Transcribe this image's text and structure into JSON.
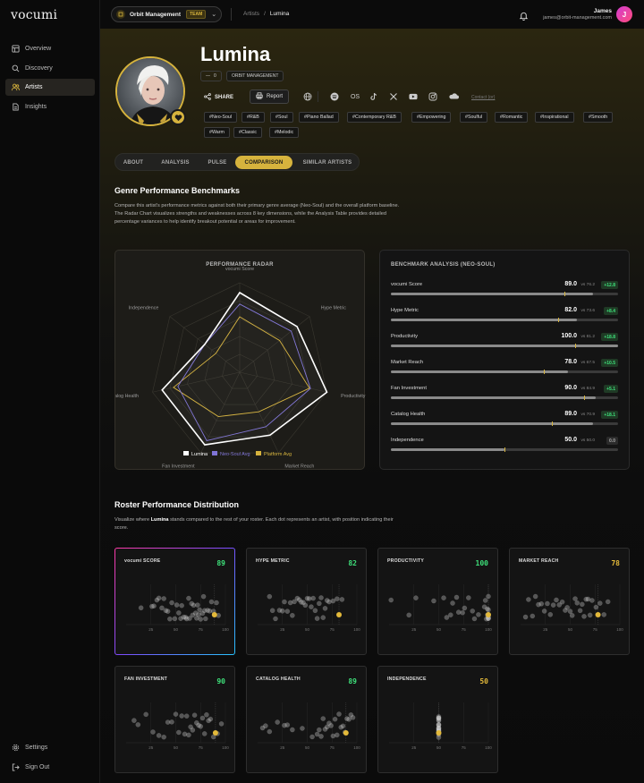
{
  "sidebar": {
    "logo": "vocumi",
    "nav": [
      {
        "label": "Overview",
        "icon": "grid-icon"
      },
      {
        "label": "Discovery",
        "icon": "search-icon"
      },
      {
        "label": "Artists",
        "icon": "users-icon",
        "active": true
      },
      {
        "label": "Insights",
        "icon": "document-icon"
      }
    ],
    "bottom": [
      {
        "label": "Settings",
        "icon": "gear-icon"
      },
      {
        "label": "Sign Out",
        "icon": "sign-out-icon"
      }
    ]
  },
  "topbar": {
    "org": "Orbit Management",
    "org_badge": "TEAM",
    "breadcrumb": [
      "Artists",
      "/",
      "Lumina"
    ],
    "user_name": "James",
    "user_email": "james@orbit-management.com",
    "avatar_letter": "J"
  },
  "artist": {
    "name": "Lumina",
    "followers": "0",
    "org_label": "ORBIT MANAGEMENT",
    "share_label": "SHARE",
    "report_label": "Report",
    "contact_label": "Contact (or)",
    "social_icons": [
      "globe-icon",
      "spotify-icon",
      "os-icon",
      "tiktok-icon",
      "x-icon",
      "youtube-icon",
      "instagram-icon",
      "soundcloud-icon"
    ],
    "os_text": "OS",
    "tags": [
      "#Neo-Soul",
      "#R&B",
      "#Soul",
      "#Piano Ballad",
      "#Contemporary R&B",
      "#Empowering",
      "#Soulful",
      "#Romantic",
      "#Inspirational",
      "#Smooth",
      "#Warm",
      "#Classic",
      "#Melodic"
    ]
  },
  "tabs": [
    "ABOUT",
    "ANALYSIS",
    "PULSE",
    "COMPARISON",
    "SIMILAR ARTISTS"
  ],
  "active_tab": "COMPARISON",
  "genre_section": {
    "title": "Genre Performance Benchmarks",
    "description_1": "Compare this artist's performance metrics against both their primary genre average (Neo-Soul) and the overall platform baseline.",
    "description_2": "The Radar Chart visualizes strengths and weaknesses across 8 key dimensions, while the Analysis Table provides detailed",
    "description_3": "percentage variances to help identify breakout potential or areas for improvement."
  },
  "radar": {
    "title": "PERFORMANCE RADAR",
    "legend": [
      "Lumina",
      "Neo-Soul Avg",
      "Platform Avg"
    ]
  },
  "chart_data": [
    {
      "type": "radar",
      "title": "PERFORMANCE RADAR",
      "axes": [
        "vocumi Score",
        "Hype Metric",
        "Productivity",
        "Market Reach",
        "Fan Investment",
        "Catalog Health",
        "Independence"
      ],
      "rmax": 100,
      "grid": true,
      "legend_position": "bottom",
      "series": [
        {
          "name": "Lumina",
          "color": "#ffffff",
          "values": [
            89,
            82,
            100,
            78,
            90,
            89,
            50
          ]
        },
        {
          "name": "Neo-Soul Avg",
          "color": "#7f74d6",
          "values": [
            76.2,
            73.6,
            81.2,
            67.5,
            84.9,
            70.9,
            50
          ]
        },
        {
          "name": "Platform Avg",
          "color": "#d6b33d",
          "values": [
            62,
            57,
            80,
            49,
            55,
            76,
            34
          ]
        }
      ]
    },
    {
      "type": "scatter",
      "title": "vocumi SCORE",
      "score": 89,
      "score_color": "#3ee07a",
      "xticks": [
        "25",
        "50",
        "75",
        "100"
      ],
      "xlim": [
        0,
        100
      ],
      "highlight_x": 89,
      "points": [
        15,
        26,
        28,
        31,
        33,
        36,
        38,
        40,
        42,
        44,
        46,
        49,
        51,
        53,
        55,
        56,
        58,
        60,
        61,
        63,
        64,
        66,
        67,
        68,
        70,
        71,
        72,
        73,
        74,
        75,
        77,
        78,
        79,
        80,
        82,
        84,
        86,
        88,
        91,
        93
      ]
    },
    {
      "type": "scatter",
      "title": "HYPE METRIC",
      "score": 82,
      "score_color": "#3ee07a",
      "xticks": [
        "25",
        "50",
        "75",
        "100"
      ],
      "xlim": [
        0,
        100
      ],
      "highlight_x": 82,
      "points": [
        12,
        15,
        18,
        22,
        25,
        27,
        30,
        33,
        35,
        37,
        40,
        42,
        44,
        46,
        48,
        50,
        52,
        54,
        56,
        58,
        60,
        62,
        64,
        66,
        68,
        70,
        72,
        76,
        80,
        85
      ]
    },
    {
      "type": "scatter",
      "title": "PRODUCTIVITY",
      "score": 100,
      "score_color": "#3ee07a",
      "xticks": [
        "25",
        "50",
        "75",
        "100"
      ],
      "xlim": [
        0,
        100
      ],
      "highlight_x": 100,
      "points": [
        2,
        20,
        27,
        45,
        55,
        58,
        62,
        64,
        68,
        70,
        74,
        76,
        80,
        84,
        86,
        90,
        96,
        97,
        98,
        99,
        99,
        100,
        100,
        100,
        100,
        100,
        100,
        100
      ]
    },
    {
      "type": "scatter",
      "title": "MARKET REACH",
      "score": 78,
      "score_color": "#e3b93a",
      "xticks": [
        "25",
        "50",
        "75",
        "100"
      ],
      "xlim": [
        0,
        100
      ],
      "highlight_x": 78,
      "points": [
        5,
        8,
        12,
        15,
        18,
        21,
        24,
        27,
        30,
        33,
        36,
        39,
        42,
        45,
        47,
        50,
        52,
        55,
        57,
        60,
        62,
        64,
        66,
        68,
        70,
        72,
        76,
        80,
        84,
        88
      ]
    },
    {
      "type": "scatter",
      "title": "FAN INVESTMENT",
      "score": 90,
      "score_color": "#3ee07a",
      "xticks": [
        "25",
        "50",
        "75",
        "100"
      ],
      "xlim": [
        0,
        100
      ],
      "highlight_x": 90,
      "points": [
        8,
        12,
        20,
        27,
        33,
        38,
        42,
        46,
        50,
        53,
        56,
        59,
        61,
        63,
        65,
        67,
        69,
        71,
        73,
        75,
        77,
        79,
        81,
        83,
        85,
        88,
        92,
        96
      ]
    },
    {
      "type": "scatter",
      "title": "CATALOG HEALTH",
      "score": 89,
      "score_color": "#3ee07a",
      "xticks": [
        "25",
        "50",
        "75",
        "100"
      ],
      "xlim": [
        0,
        100
      ],
      "highlight_x": 89,
      "points": [
        5,
        8,
        12,
        20,
        27,
        30,
        35,
        45,
        55,
        60,
        62,
        64,
        66,
        68,
        70,
        72,
        74,
        76,
        78,
        80,
        82,
        84,
        86,
        88,
        90,
        92,
        94,
        96
      ]
    },
    {
      "type": "scatter",
      "title": "INDEPENDENCE",
      "score": 50,
      "score_color": "#e3b93a",
      "xticks": [
        "25",
        "50",
        "75",
        "100"
      ],
      "xlim": [
        0,
        100
      ],
      "highlight_x": 50,
      "points": [
        50,
        50,
        50,
        50,
        50,
        50,
        50,
        50,
        50,
        50,
        50,
        50,
        50,
        50,
        50,
        50,
        50,
        50,
        50,
        50
      ]
    }
  ],
  "benchmark": {
    "title": "BENCHMARK ANALYSIS (NEO-SOUL)",
    "rows": [
      {
        "label": "vocumi Score",
        "value": "89.0",
        "vs": "vs 76.2",
        "delta": "+12.8",
        "v": 89,
        "avg": 76.2
      },
      {
        "label": "Hype Metric",
        "value": "82.0",
        "vs": "vs 73.6",
        "delta": "+8.4",
        "v": 82,
        "avg": 73.6
      },
      {
        "label": "Productivity",
        "value": "100.0",
        "vs": "vs 81.2",
        "delta": "+18.8",
        "v": 100,
        "avg": 81.2
      },
      {
        "label": "Market Reach",
        "value": "78.0",
        "vs": "vs 67.5",
        "delta": "+10.5",
        "v": 78,
        "avg": 67.5
      },
      {
        "label": "Fan Investment",
        "value": "90.0",
        "vs": "vs 84.9",
        "delta": "+5.1",
        "v": 90,
        "avg": 84.9
      },
      {
        "label": "Catalog Health",
        "value": "89.0",
        "vs": "vs 70.9",
        "delta": "+18.1",
        "v": 89,
        "avg": 70.9
      },
      {
        "label": "Independence",
        "value": "50.0",
        "vs": "vs 50.0",
        "delta": "0.0",
        "v": 50,
        "avg": 50
      }
    ]
  },
  "roster_section": {
    "title": "Roster Performance Distribution",
    "desc_pre": "Visualize where ",
    "desc_name": "Lumina",
    "desc_post": " stands compared to the rest of your roster. Each dot represents an artist, with position indicating their",
    "desc_2": "score."
  },
  "colors": {
    "accent": "#d6b33d",
    "positive": "#3ee07a",
    "neo_soul": "#7f74d6",
    "warn": "#e3b93a"
  }
}
